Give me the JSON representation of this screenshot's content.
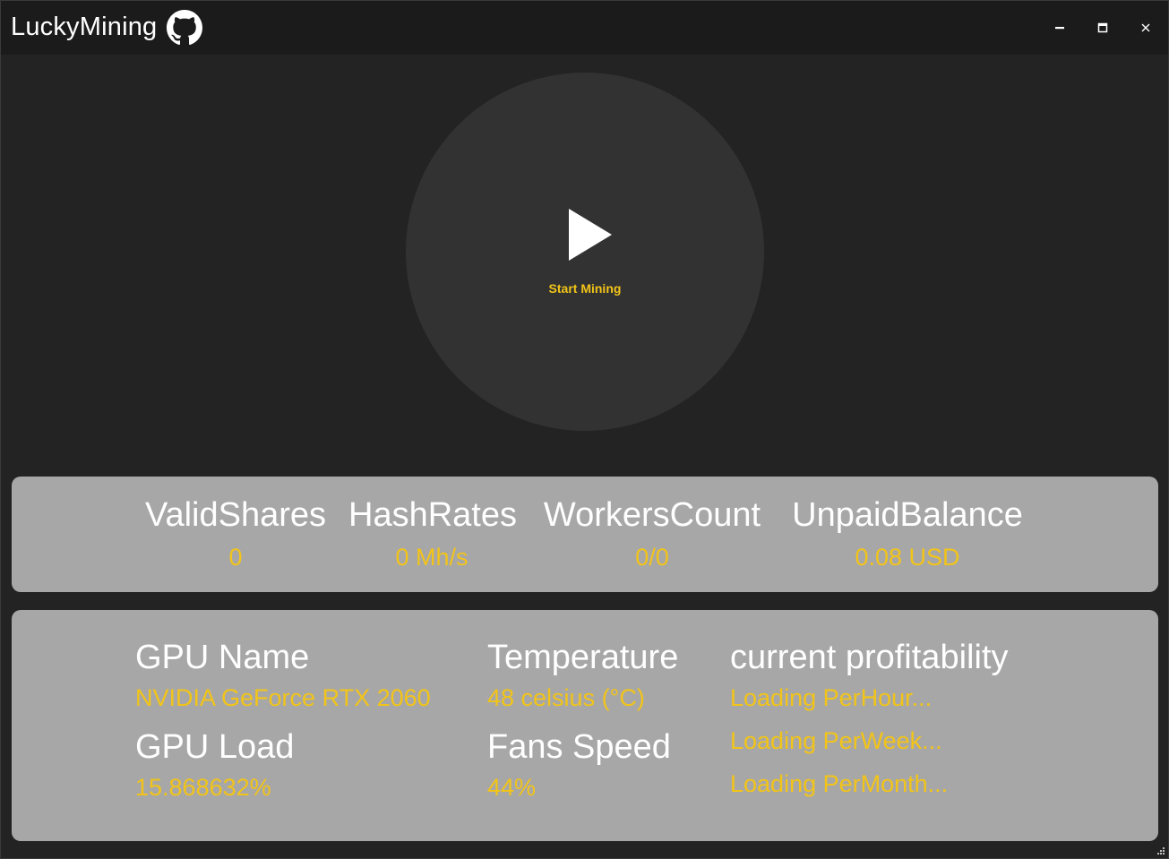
{
  "window": {
    "title": "LuckyMining"
  },
  "colors": {
    "accent": "#f2c419",
    "panel": "#a7a7a7",
    "background": "#232323",
    "titlebar": "#1b1b1b",
    "circle": "#323232"
  },
  "icons": {
    "title_icon": "github-icon",
    "minimize": "minimize-icon",
    "maximize": "maximize-icon",
    "close": "close-icon",
    "play": "play-icon"
  },
  "mining": {
    "start_label": "Start Mining"
  },
  "stats": [
    {
      "label": "ValidShares",
      "value": "0"
    },
    {
      "label": "HashRates",
      "value": "0 Mh/s"
    },
    {
      "label": "WorkersCount",
      "value": "0/0"
    },
    {
      "label": "UnpaidBalance",
      "value": "0.08 USD"
    }
  ],
  "gpu": {
    "name_label": "GPU Name",
    "name_value": "NVIDIA GeForce RTX 2060",
    "load_label": "GPU Load",
    "load_value": "15.868632%",
    "temp_label": "Temperature",
    "temp_value": "48 celsius (°C)",
    "fans_label": "Fans Speed",
    "fans_value": "44%",
    "profit_label": "current profitability",
    "profit_hour": "Loading PerHour...",
    "profit_week": "Loading PerWeek...",
    "profit_month": "Loading PerMonth..."
  }
}
